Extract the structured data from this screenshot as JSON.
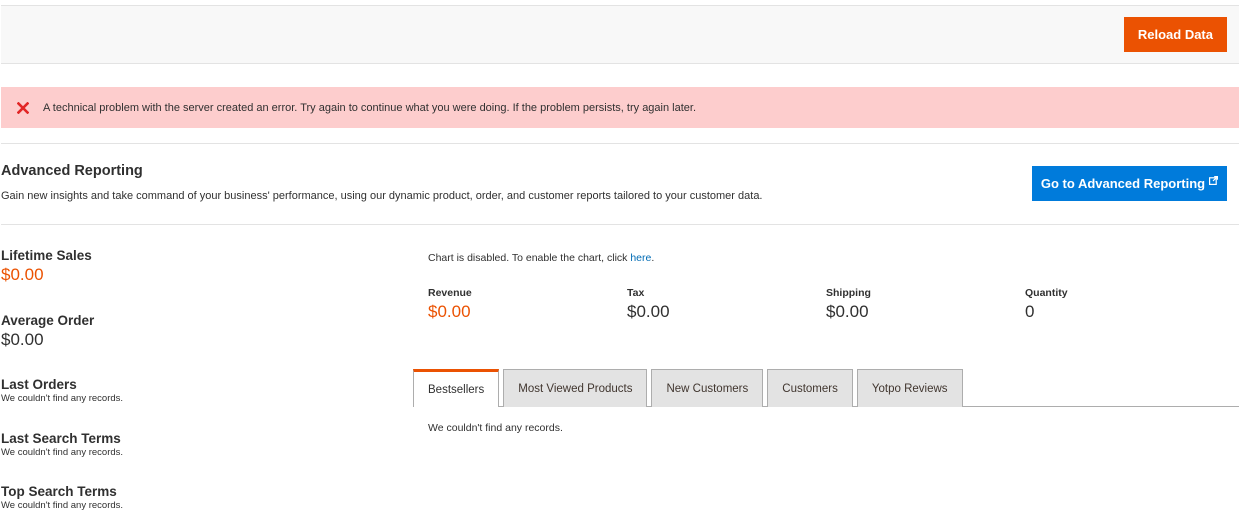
{
  "toolbar": {
    "reload_label": "Reload Data"
  },
  "error": {
    "text": "A technical problem with the server created an error. Try again to continue what you were doing. If the problem persists, try again later."
  },
  "advanced": {
    "title": "Advanced Reporting",
    "description": "Gain new insights and take command of your business' performance, using our dynamic product, order, and customer reports tailored to your customer data.",
    "button_label": "Go to Advanced Reporting"
  },
  "sidebar": {
    "lifetime_sales": {
      "title": "Lifetime Sales",
      "value": "$0.00"
    },
    "average_order": {
      "title": "Average Order",
      "value": "$0.00"
    },
    "last_orders": {
      "title": "Last Orders",
      "note": "We couldn't find any records."
    },
    "last_search_terms": {
      "title": "Last Search Terms",
      "note": "We couldn't find any records."
    },
    "top_search_terms": {
      "title": "Top Search Terms",
      "note": "We couldn't find any records."
    }
  },
  "chart": {
    "disabled_text": "Chart is disabled. To enable the chart, click ",
    "link_text": "here",
    "after_link": "."
  },
  "totals": {
    "revenue": {
      "label": "Revenue",
      "value": "$0.00"
    },
    "tax": {
      "label": "Tax",
      "value": "$0.00"
    },
    "shipping": {
      "label": "Shipping",
      "value": "$0.00"
    },
    "quantity": {
      "label": "Quantity",
      "value": "0"
    }
  },
  "tabs": [
    {
      "label": "Bestsellers",
      "active": true
    },
    {
      "label": "Most Viewed Products"
    },
    {
      "label": "New Customers"
    },
    {
      "label": "Customers"
    },
    {
      "label": "Yotpo Reviews"
    }
  ],
  "tab_content": {
    "empty_text": "We couldn't find any records."
  },
  "colors": {
    "accent": "#eb5202",
    "primary_button": "#007bdb",
    "error_bg": "#fdcdcd",
    "error_icon": "#e22626"
  }
}
